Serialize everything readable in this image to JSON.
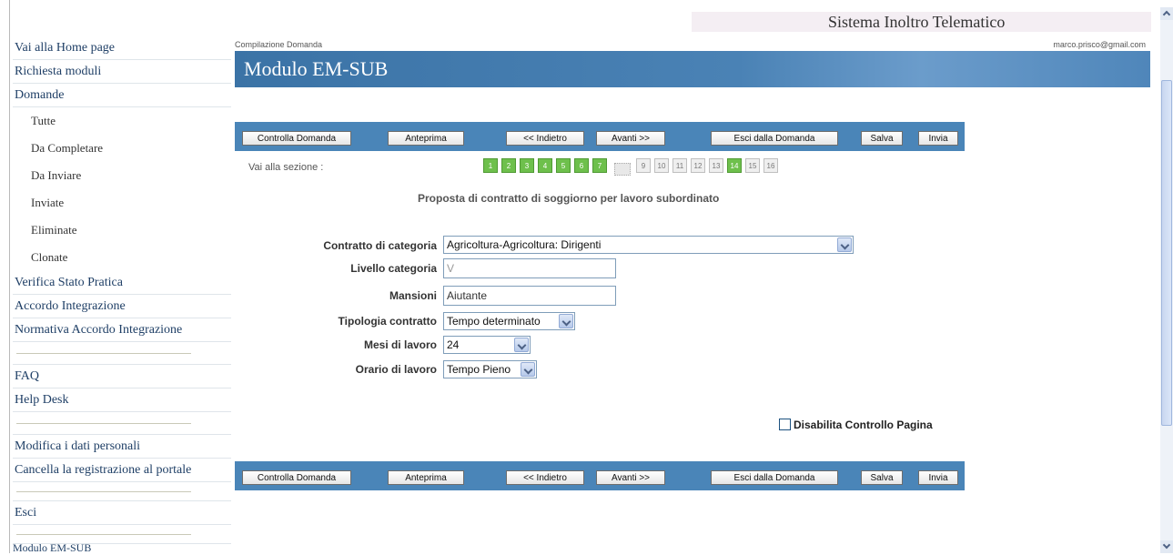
{
  "header": {
    "system_title": "Sistema Inoltro Telematico",
    "breadcrumb": "Compilazione Domanda",
    "user_email": "marco.prisco@gmail.com",
    "page_title": "Modulo EM-SUB"
  },
  "sidebar": {
    "home": "Vai alla Home page",
    "richiesta": "Richiesta moduli",
    "domande": "Domande",
    "tutte": "Tutte",
    "da_completare": "Da Completare",
    "da_inviare": "Da Inviare",
    "inviate": "Inviate",
    "eliminate": "Eliminate",
    "clonate": "Clonate",
    "verifica": "Verifica Stato Pratica",
    "accordo": "Accordo Integrazione",
    "normativa": "Normativa Accordo Integrazione",
    "faq": "FAQ",
    "helpdesk": "Help Desk",
    "modifica": "Modifica i dati personali",
    "cancella": "Cancella la registrazione al portale",
    "esci": "Esci",
    "footer": "Modulo EM-SUB"
  },
  "toolbar": {
    "controlla": "Controlla Domanda",
    "anteprima": "Anteprima",
    "indietro": "<< Indietro",
    "avanti": "Avanti >>",
    "esci": "Esci dalla Domanda",
    "salva": "Salva",
    "invia": "Invia"
  },
  "sections": {
    "label": "Vai alla sezione :",
    "items": [
      "1",
      "2",
      "3",
      "4",
      "5",
      "6",
      "7",
      "",
      "9",
      "10",
      "11",
      "12",
      "13",
      "14",
      "15",
      "16"
    ],
    "completed": [
      "1",
      "2",
      "3",
      "4",
      "5",
      "6",
      "7",
      "14"
    ],
    "current": "8"
  },
  "form": {
    "title": "Proposta di contratto di soggiorno per lavoro subordinato",
    "contratto_label": "Contratto di categoria",
    "contratto_value": "Agricoltura-Agricoltura: Dirigenti",
    "livello_label": "Livello categoria",
    "livello_value": "V",
    "mansioni_label": "Mansioni",
    "mansioni_value": "Aiutante",
    "tipologia_label": "Tipologia contratto",
    "tipologia_value": "Tempo determinato",
    "mesi_label": "Mesi di lavoro",
    "mesi_value": "24",
    "orario_label": "Orario di lavoro",
    "orario_value": "Tempo Pieno",
    "disable_check_label": "Disabilita Controllo Pagina",
    "disable_check_value": false
  },
  "colors": {
    "toolbar": "#4a85b8",
    "banner": "#3b73a6",
    "section_done": "#6ec04c",
    "nav_text": "#1f3f66"
  }
}
